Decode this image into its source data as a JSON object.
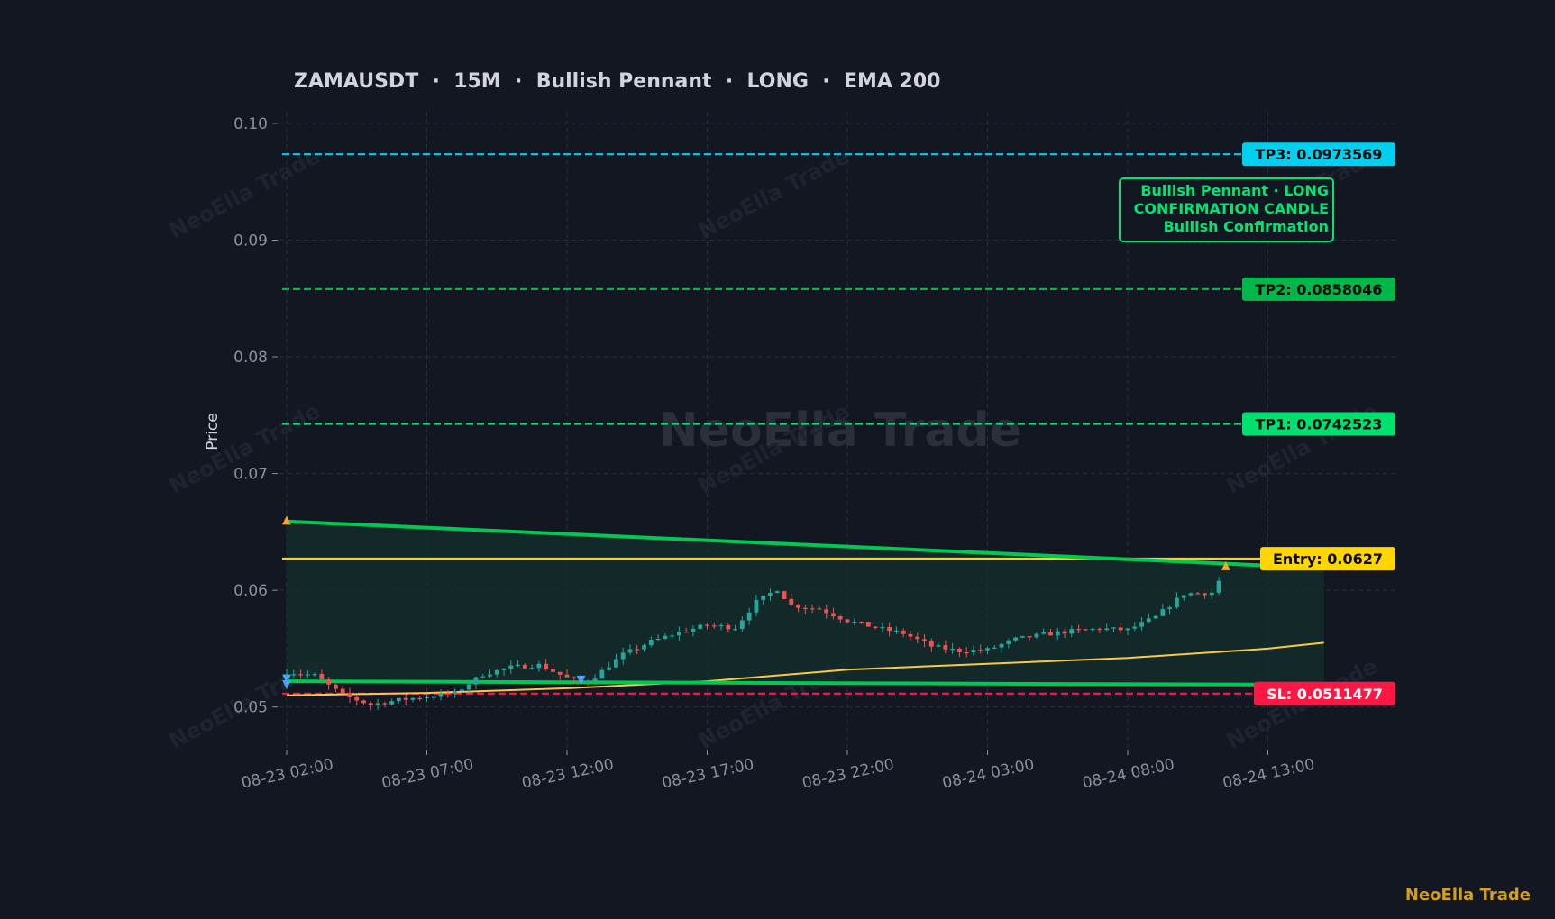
{
  "colors": {
    "background": "#131722",
    "grid": "#2a2e39",
    "tick_text": "#8a8f9c",
    "title_text": "#d1d4dc",
    "candle_up": "#26a69a",
    "candle_down": "#ef5350",
    "pennant": "#00c853",
    "entry": "#ffd600",
    "ema": "#f7c948",
    "tp3": "#00d0f0",
    "tp2": "#00b84a",
    "tp1": "#00e070",
    "sl": "#ff1744",
    "annotation": "#00e676",
    "watermark_corner": "#d4a017"
  },
  "watermark": {
    "center": "NeoElla Trade",
    "tile": "NeoElla Trade",
    "corner": "NeoElla Trade"
  },
  "chart_data": {
    "type": "candlestick",
    "title": "ZAMAUSDT  ·  15M  ·  Bullish Pennant  ·  LONG  ·  EMA 200",
    "ylabel": "Price",
    "xlabel": "",
    "x_start": "08-23 02:00",
    "candle_interval_minutes": 15,
    "candle_count": 134,
    "ylim": [
      0.0465,
      0.101
    ],
    "yticks": [
      0.05,
      0.06,
      0.07,
      0.08,
      0.09,
      0.1
    ],
    "ytick_labels": [
      "0.05",
      "0.06",
      "0.07",
      "0.08",
      "0.09",
      "0.10"
    ],
    "xticks": [
      "08-23 02:00",
      "08-23 07:00",
      "08-23 12:00",
      "08-23 17:00",
      "08-23 22:00",
      "08-24 03:00",
      "08-24 08:00",
      "08-24 13:00"
    ],
    "grid": true,
    "close_path": [
      [
        "08-23 02:00",
        0.053
      ],
      [
        "08-23 03:00",
        0.0527
      ],
      [
        "08-23 04:00",
        0.051
      ],
      [
        "08-23 05:00",
        0.0502
      ],
      [
        "08-23 06:00",
        0.0506
      ],
      [
        "08-23 07:00",
        0.0509
      ],
      [
        "08-23 08:00",
        0.0512
      ],
      [
        "08-23 09:00",
        0.0528
      ],
      [
        "08-23 10:00",
        0.0534
      ],
      [
        "08-23 11:00",
        0.0536
      ],
      [
        "08-23 12:00",
        0.0525
      ],
      [
        "08-23 12:30",
        0.0521
      ],
      [
        "08-23 13:00",
        0.0526
      ],
      [
        "08-23 14:00",
        0.0545
      ],
      [
        "08-23 15:00",
        0.0556
      ],
      [
        "08-23 16:00",
        0.0564
      ],
      [
        "08-23 17:00",
        0.057
      ],
      [
        "08-23 18:00",
        0.0568
      ],
      [
        "08-23 18:45",
        0.059
      ],
      [
        "08-23 19:30",
        0.0601
      ],
      [
        "08-23 20:00",
        0.0587
      ],
      [
        "08-23 21:00",
        0.0584
      ],
      [
        "08-23 22:00",
        0.0574
      ],
      [
        "08-23 23:00",
        0.0568
      ],
      [
        "08-24 00:00",
        0.0563
      ],
      [
        "08-24 01:00",
        0.0552
      ],
      [
        "08-24 02:00",
        0.0548
      ],
      [
        "08-24 03:00",
        0.0549
      ],
      [
        "08-24 04:00",
        0.0558
      ],
      [
        "08-24 05:00",
        0.0562
      ],
      [
        "08-24 06:00",
        0.0565
      ],
      [
        "08-24 07:00",
        0.0567
      ],
      [
        "08-24 08:00",
        0.0566
      ],
      [
        "08-24 09:00",
        0.0577
      ],
      [
        "08-24 10:00",
        0.0597
      ],
      [
        "08-24 11:00",
        0.0598
      ],
      [
        "08-24 11:30",
        0.0618
      ],
      [
        "08-24 12:00",
        0.0596
      ],
      [
        "08-24 13:00",
        0.0582
      ],
      [
        "08-24 14:00",
        0.0605
      ],
      [
        "08-24 15:00",
        0.062
      ]
    ],
    "ema_200": [
      [
        "08-23 02:00",
        0.051
      ],
      [
        "08-23 07:00",
        0.0512
      ],
      [
        "08-23 12:00",
        0.0516
      ],
      [
        "08-23 17:00",
        0.0522
      ],
      [
        "08-23 22:00",
        0.0532
      ],
      [
        "08-24 03:00",
        0.0537
      ],
      [
        "08-24 08:00",
        0.0542
      ],
      [
        "08-24 13:00",
        0.055
      ],
      [
        "08-24 15:00",
        0.0555
      ]
    ],
    "pennant": {
      "upper": [
        [
          "08-23 02:00",
          0.0659
        ],
        [
          "08-24 15:00",
          0.0619
        ]
      ],
      "lower": [
        [
          "08-23 02:00",
          0.0522
        ],
        [
          "08-24 15:00",
          0.0519
        ]
      ]
    },
    "levels": [
      {
        "key": "tp3",
        "value": 0.0973569,
        "label": "TP3: 0.0973569",
        "style": "dashed"
      },
      {
        "key": "tp2",
        "value": 0.0858046,
        "label": "TP2: 0.0858046",
        "style": "dashed"
      },
      {
        "key": "tp1",
        "value": 0.0742523,
        "label": "TP1: 0.0742523",
        "style": "dashed"
      },
      {
        "key": "entry",
        "value": 0.0627,
        "label": "Entry: 0.0627",
        "style": "solid"
      },
      {
        "key": "sl",
        "value": 0.0511477,
        "label": "SL: 0.0511477",
        "style": "dashed"
      }
    ],
    "annotation": [
      "Bullish Pennant · LONG",
      "CONFIRMATION CANDLE",
      "Bullish Confirmation"
    ],
    "markers": [
      {
        "x": "08-23 02:00",
        "y": 0.066,
        "type": "up",
        "color": "#f5a623"
      },
      {
        "x": "08-23 02:00",
        "y": 0.0524,
        "type": "down",
        "color": "#42a5f5"
      },
      {
        "x": "08-23 02:00",
        "y": 0.0519,
        "type": "down",
        "color": "#42a5f5"
      },
      {
        "x": "08-23 12:30",
        "y": 0.0523,
        "type": "down",
        "color": "#42a5f5"
      },
      {
        "x": "08-24 11:30",
        "y": 0.0621,
        "type": "up",
        "color": "#f5a623"
      }
    ]
  }
}
